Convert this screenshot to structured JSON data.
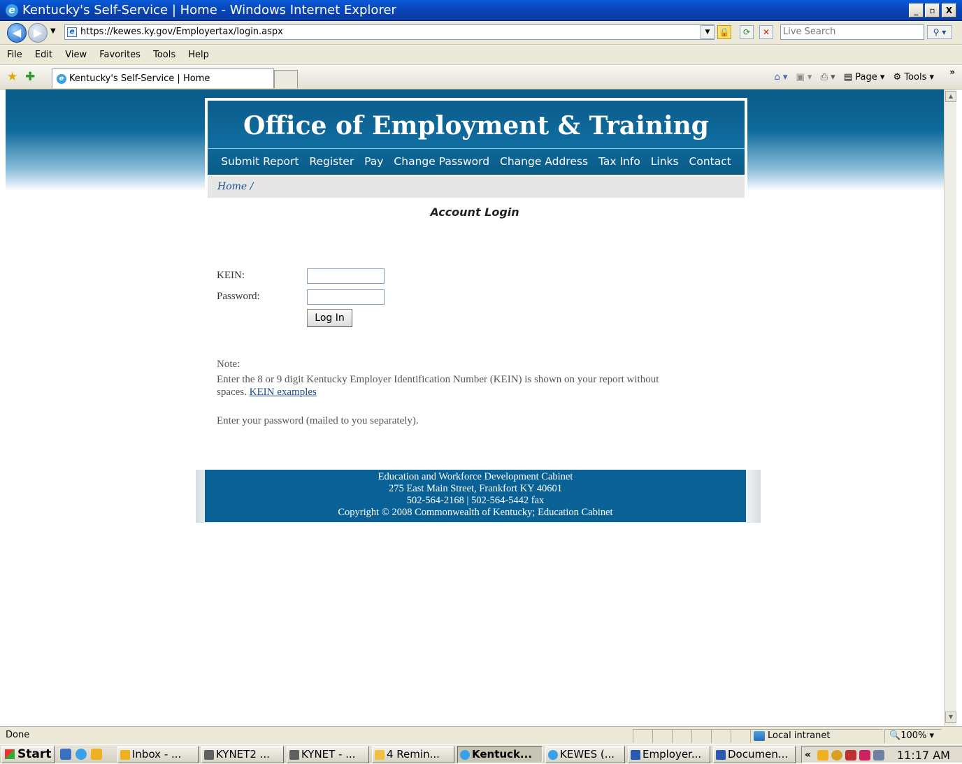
{
  "window": {
    "title": "Kentucky's Self-Service | Home - Windows Internet Explorer",
    "controls": {
      "minimize": "_",
      "maximize": "▫",
      "close": "X"
    }
  },
  "navbar": {
    "url": "https://kewes.ky.gov/Employertax/login.aspx",
    "search_placeholder": "Live Search"
  },
  "menu": [
    "File",
    "Edit",
    "View",
    "Favorites",
    "Tools",
    "Help"
  ],
  "tabs": {
    "active_label": "Kentucky's Self-Service | Home",
    "page_label": "Page ▾",
    "tools_label": "Tools ▾"
  },
  "site": {
    "title": "Office of Employment & Training",
    "nav": [
      "Submit Report",
      "Register",
      "Pay",
      "Change Password",
      "Change Address",
      "Tax Info",
      "Links",
      "Contact"
    ],
    "breadcrumb": "Home /"
  },
  "login": {
    "heading": "Account Login",
    "kein_label": "KEIN:",
    "password_label": "Password:",
    "kein_value": "",
    "password_value": "",
    "submit_label": "Log In"
  },
  "notes": {
    "note_label": "Note:",
    "kein_note_line1": "Enter the 8 or 9 digit Kentucky Employer Identification Number (KEIN) is shown on your report without",
    "kein_note_line2": "spaces.",
    "kein_examples_link": "KEIN examples",
    "password_note": "Enter your password (mailed to you separately)."
  },
  "footer": {
    "line1": "Education and Workforce Development Cabinet",
    "line2": "275 East Main Street, Frankfort KY 40601",
    "line3": "502-564-2168 | 502-564-5442 fax",
    "line4": "Copyright © 2008 Commonwealth of Kentucky; Education Cabinet"
  },
  "status": {
    "text": "Done",
    "zone": "Local intranet",
    "zoom": "100%"
  },
  "taskbar": {
    "start_label": "Start",
    "tasks": [
      "Inbox - ...",
      "KYNET2 ...",
      "KYNET - ...",
      "4 Remin...",
      "Kentuck...",
      "KEWES (...",
      "Employer...",
      "Documen..."
    ],
    "clock": "11:17 AM"
  },
  "colors": {
    "brand_blue": "#0b5d8c",
    "link_blue": "#1a4d8f"
  }
}
